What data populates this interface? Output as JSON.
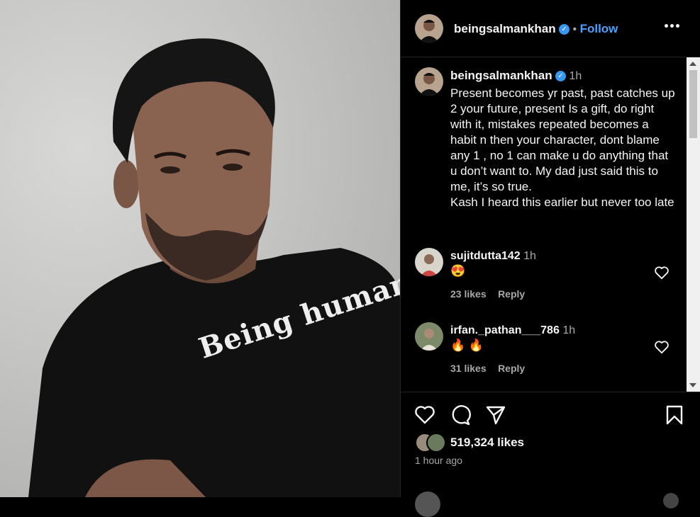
{
  "post": {
    "username": "beingsalmankhan",
    "verified": true,
    "follow_label": "Follow",
    "separator": "•",
    "shirt_text": "Being human"
  },
  "caption": {
    "username": "beingsalmankhan",
    "time": "1h",
    "text": "Present becomes yr past, past catches up 2 your future, present Is a gift, do right with it, mistakes repeated becomes a habit n then your character, dont blame any 1 , no 1 can make u do anything that u don’t want to. My dad just said this to me, it’s so true.",
    "text2": "Kash I heard this earlier but never too late"
  },
  "comments": [
    {
      "username": "sujitdutta142",
      "time": "1h",
      "text": "😍",
      "likes": "23 likes",
      "reply": "Reply"
    },
    {
      "username": "irfan._pathan___786",
      "time": "1h",
      "text": "🔥 🔥",
      "likes": "31 likes",
      "reply": "Reply"
    }
  ],
  "footer": {
    "likes": "519,324 likes",
    "time_ago": "1 hour ago"
  },
  "icons": [
    "heart-icon",
    "comment-icon",
    "share-icon",
    "bookmark-icon",
    "verified-badge-icon",
    "more-options-icon"
  ],
  "colors": {
    "background": "#000000",
    "link": "#4aa0ff",
    "verified": "#3897f0",
    "muted": "#a8a8a8"
  }
}
